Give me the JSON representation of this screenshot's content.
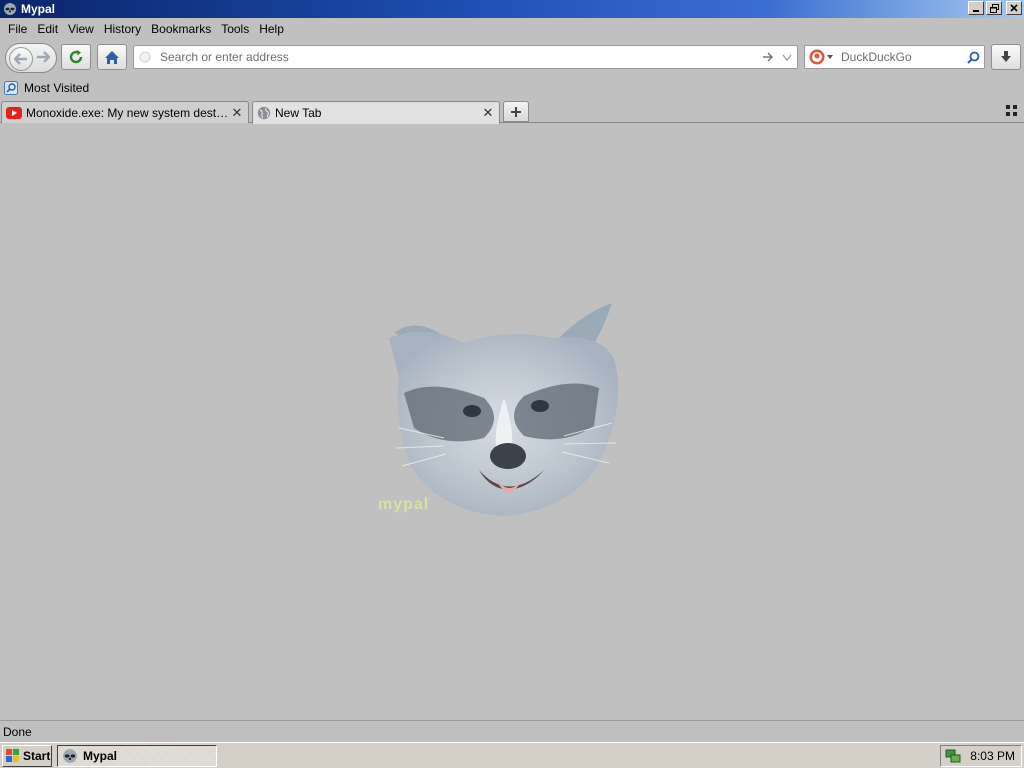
{
  "window": {
    "title": "Mypal"
  },
  "menu": {
    "items": [
      {
        "label": "File"
      },
      {
        "label": "Edit"
      },
      {
        "label": "View"
      },
      {
        "label": "History"
      },
      {
        "label": "Bookmarks"
      },
      {
        "label": "Tools"
      },
      {
        "label": "Help"
      }
    ]
  },
  "nav": {
    "url_placeholder": "Search or enter address",
    "search_placeholder": "DuckDuckGo"
  },
  "bookmarks": {
    "items": [
      {
        "label": "Most Visited"
      }
    ]
  },
  "tabs": [
    {
      "title": "Monoxide.exe: My new system destroying ...",
      "active": false,
      "icon": "youtube-icon"
    },
    {
      "title": "New Tab",
      "active": true,
      "icon": "globe-icon"
    }
  ],
  "content": {
    "watermark": "mypal"
  },
  "status": {
    "text": "Done"
  },
  "taskbar": {
    "start_label": "Start",
    "task_label": "Mypal",
    "clock": "8:03 PM"
  },
  "colors": {
    "titlebar_start": "#0a246a",
    "titlebar_end": "#a6caf0",
    "background": "#c0c0c0",
    "youtube_red": "#e62117"
  }
}
